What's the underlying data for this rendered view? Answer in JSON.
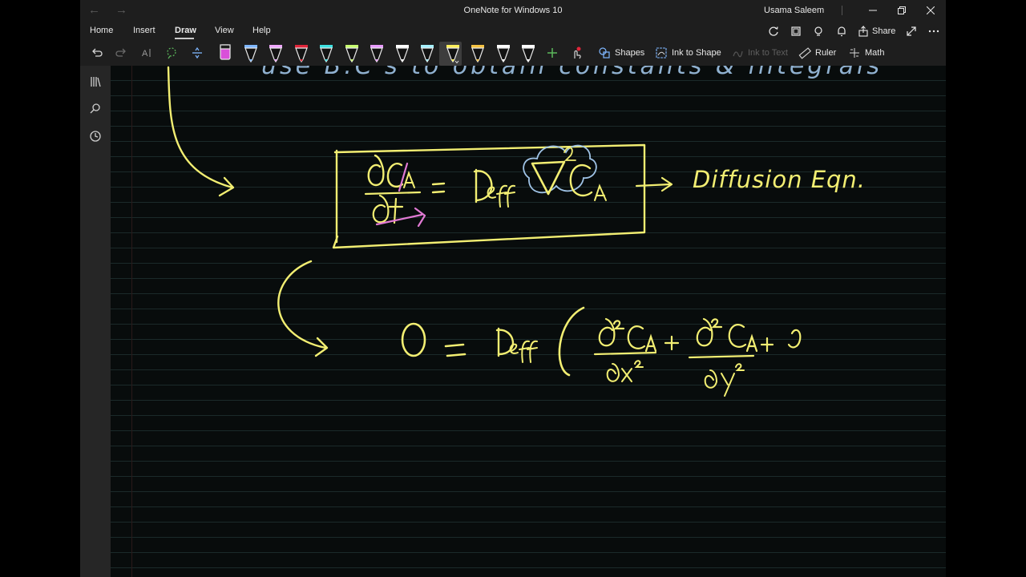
{
  "titlebar": {
    "app_title": "OneNote for Windows 10",
    "user_name": "Usama Saleem"
  },
  "tabs": [
    {
      "label": "Home"
    },
    {
      "label": "Insert"
    },
    {
      "label": "Draw",
      "active": true
    },
    {
      "label": "View"
    },
    {
      "label": "Help"
    }
  ],
  "share_label": "Share",
  "tools": {
    "shapes_label": "Shapes",
    "ink_to_shape_label": "Ink to Shape",
    "ink_to_text_label": "Ink to Text",
    "ruler_label": "Ruler",
    "math_label": "Math"
  },
  "pens": [
    {
      "color": "#d94fd9",
      "type": "highlighter"
    },
    {
      "color": "#7fb7ff",
      "type": "pen"
    },
    {
      "color": "#f0a8ff",
      "type": "pen"
    },
    {
      "color": "#e0263a",
      "type": "pen"
    },
    {
      "color": "#3fe2e2",
      "type": "pen"
    },
    {
      "color": "#c8ff70",
      "type": "pen"
    },
    {
      "color": "#e89cff",
      "type": "pen"
    },
    {
      "color": "#ffffff",
      "type": "pen"
    },
    {
      "color": "#a5f0ff",
      "type": "pen"
    },
    {
      "color": "#ffef5a",
      "type": "pen",
      "selected": true
    },
    {
      "color": "#f5c242",
      "type": "pen"
    },
    {
      "color": "#ffffff",
      "type": "pen"
    },
    {
      "color": "#ffffff",
      "type": "pen"
    }
  ],
  "colors": {
    "ink_yellow": "#f2ee72",
    "ink_pink": "#e17ad4",
    "ink_blue": "#9fc3e6",
    "accent_green": "#5cb85c"
  },
  "ink": {
    "top_partial_line": "use  B.C's  to obtain  constants & integrals",
    "label_diffusion": "Diffusion Eqn."
  }
}
